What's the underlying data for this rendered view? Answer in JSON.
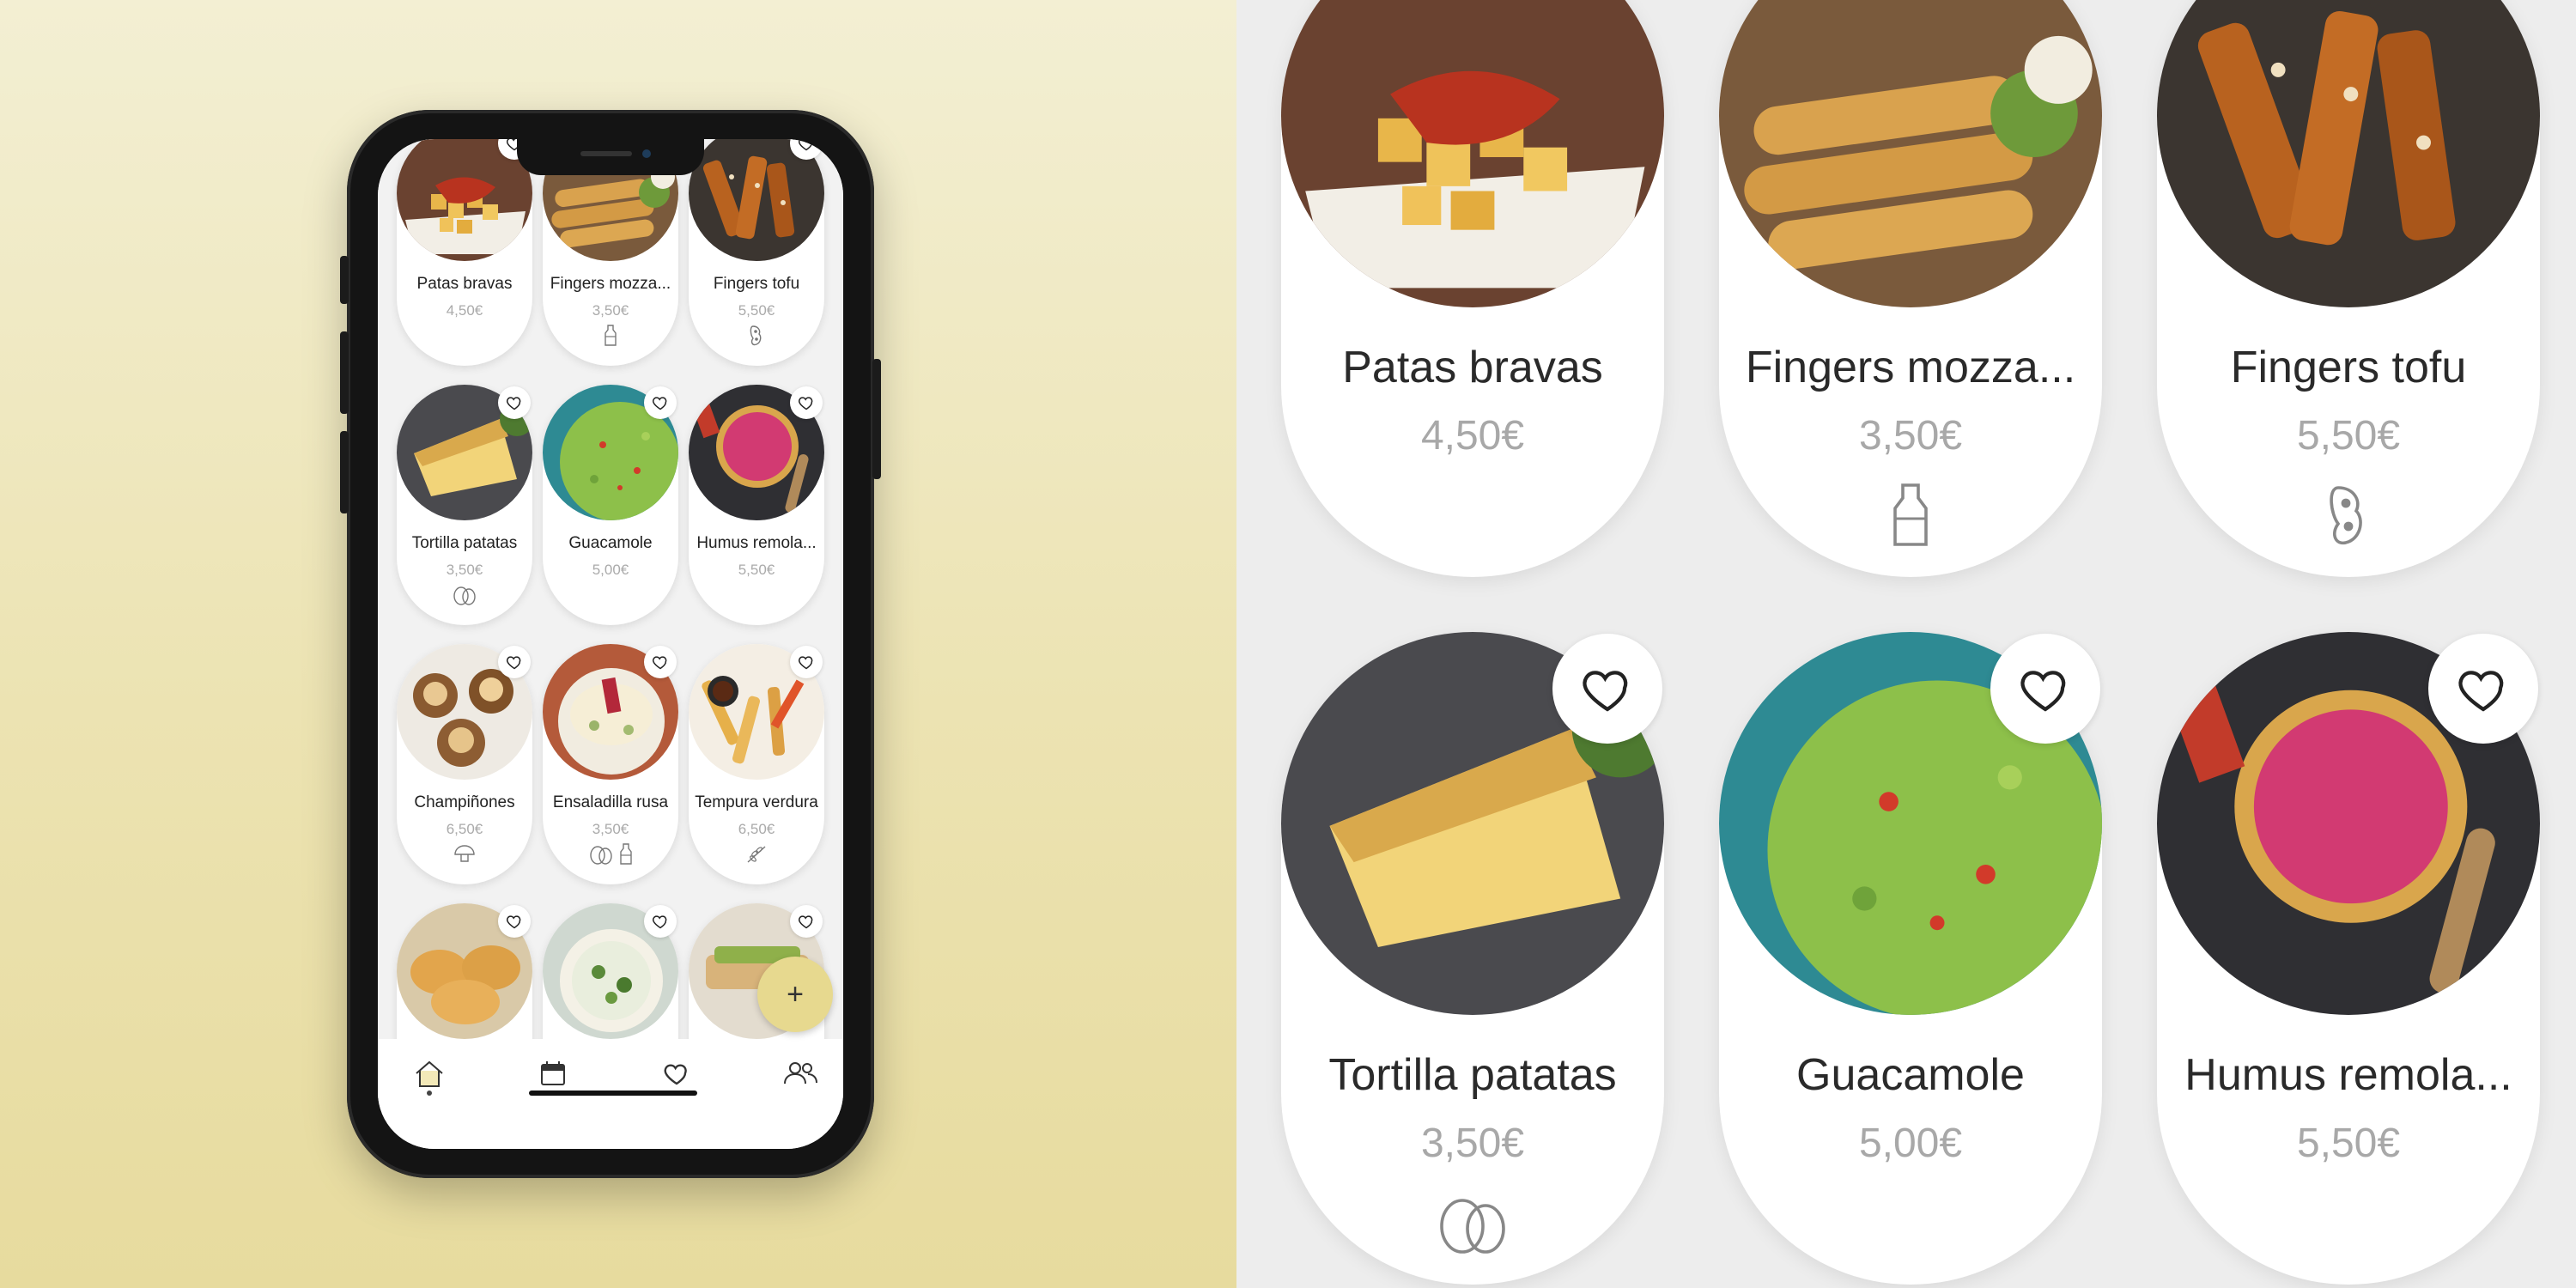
{
  "app": {
    "colors": {
      "accent": "#e7d98f",
      "background": "#f2f2f2",
      "price": "#aaaaaa"
    },
    "fab_label": "+",
    "menu_items": [
      {
        "name": "Patas bravas",
        "price": "4,50€",
        "allergens": []
      },
      {
        "name": "Fingers mozza...",
        "price": "3,50€",
        "allergens": [
          "milk-bottle-icon"
        ]
      },
      {
        "name": "Fingers tofu",
        "price": "5,50€",
        "allergens": [
          "soy-icon"
        ]
      },
      {
        "name": "Tortilla patatas",
        "price": "3,50€",
        "allergens": [
          "eggs-icon"
        ]
      },
      {
        "name": "Guacamole",
        "price": "5,00€",
        "allergens": []
      },
      {
        "name": "Humus remola...",
        "price": "5,50€",
        "allergens": []
      },
      {
        "name": "Champiñones",
        "price": "6,50€",
        "allergens": [
          "mushroom-icon"
        ]
      },
      {
        "name": "Ensaladilla rusa",
        "price": "3,50€",
        "allergens": [
          "eggs-icon",
          "milk-bottle-icon"
        ]
      },
      {
        "name": "Tempura verdura",
        "price": "6,50€",
        "allergens": [
          "wheat-icon"
        ]
      },
      {
        "name": "",
        "price": "",
        "allergens": []
      },
      {
        "name": "",
        "price": "",
        "allergens": []
      },
      {
        "name": "",
        "price": "",
        "allergens": []
      }
    ],
    "tabs": [
      {
        "id": "home",
        "icon": "home-icon",
        "active": true
      },
      {
        "id": "calendar",
        "icon": "calendar-icon",
        "active": false
      },
      {
        "id": "favorites",
        "icon": "heart-icon",
        "active": false
      },
      {
        "id": "people",
        "icon": "people-icon",
        "active": false
      }
    ]
  },
  "zoom": {
    "cards": [
      {
        "name": "Patas bravas",
        "price": "4,50€",
        "allergens": []
      },
      {
        "name": "Fingers mozza...",
        "price": "3,50€",
        "allergens": [
          "milk-bottle-icon"
        ]
      },
      {
        "name": "Fingers tofu",
        "price": "5,50€",
        "allergens": [
          "soy-icon"
        ]
      },
      {
        "name": "Tortilla patatas",
        "price": "3,50€",
        "allergens": [
          "eggs-icon"
        ]
      },
      {
        "name": "Guacamole",
        "price": "5,00€",
        "allergens": []
      },
      {
        "name": "Humus remola...",
        "price": "5,50€",
        "allergens": []
      }
    ]
  }
}
